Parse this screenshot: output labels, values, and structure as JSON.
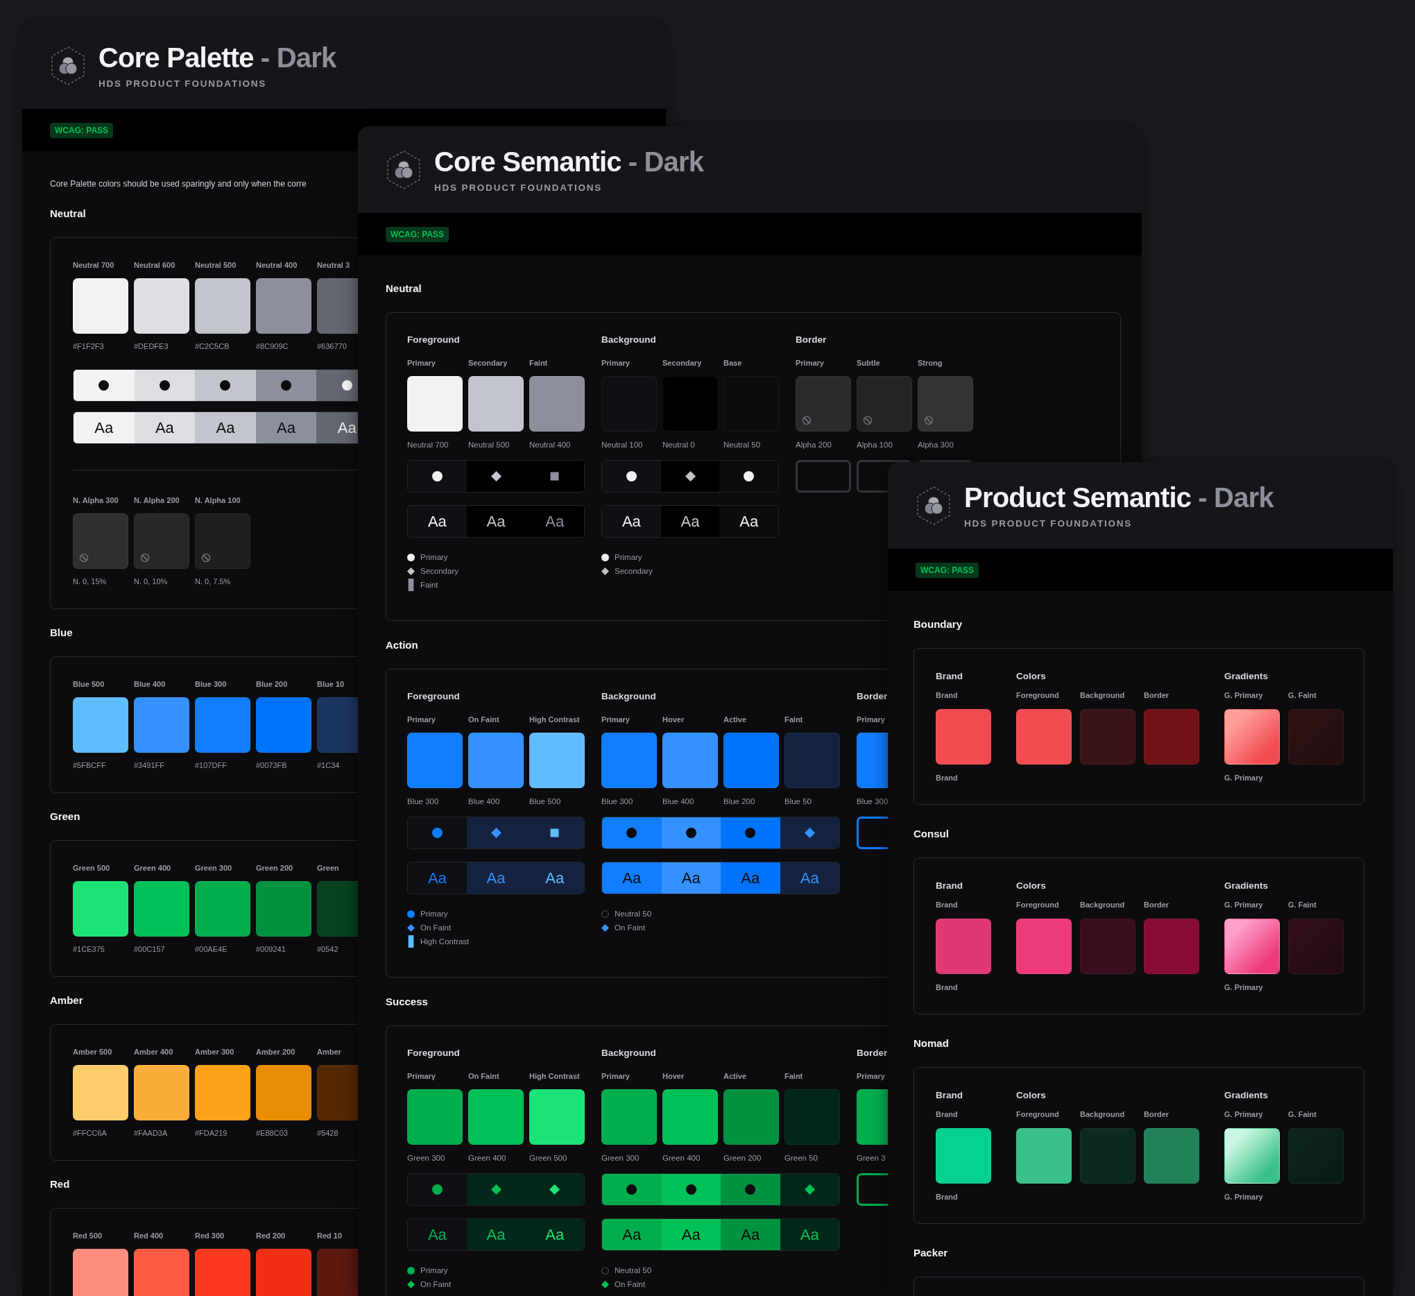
{
  "frames": [
    {
      "kind": "palette",
      "title": "Core Palette",
      "variant": "- Dark",
      "subtitle": "HDS PRODUCT FOUNDATIONS",
      "badge": "WCAG: PASS",
      "description": "Core Palette colors should be used sparingly and only when the corre",
      "sections": [
        {
          "kind": "neutral",
          "name": "Neutral",
          "swatches": [
            {
              "label": "Neutral 700",
              "color": "#f1f2f3",
              "hex": "#F1F2F3"
            },
            {
              "label": "Neutral 600",
              "color": "#dedfe3",
              "hex": "#DEDFE3"
            },
            {
              "label": "Neutral 500",
              "color": "#c2c5cb",
              "hex": "#C2C5CB"
            },
            {
              "label": "Neutral 400",
              "color": "#8c909c",
              "hex": "#8C909C"
            },
            {
              "label": "Neutral 3",
              "color": "#636770",
              "hex": "#636770"
            }
          ],
          "samples": [
            "Aa",
            "Aa",
            "Aa",
            "Aa",
            "Aa"
          ],
          "alphas": [
            {
              "label": "N. Alpha 300",
              "color": "#2f2f32",
              "value": "N. 0, 15%"
            },
            {
              "label": "N. Alpha 200",
              "color": "#27272a",
              "value": "N. 0, 10%"
            },
            {
              "label": "N. Alpha 100",
              "color": "#1f1f22",
              "value": "N. 0, 7.5%"
            }
          ]
        },
        {
          "kind": "scale",
          "name": "Blue",
          "swatches": [
            {
              "label": "Blue 500",
              "color": "#5fbcff",
              "hex": "#5FBCFF"
            },
            {
              "label": "Blue 400",
              "color": "#3491ff",
              "hex": "#3491FF"
            },
            {
              "label": "Blue 300",
              "color": "#107dff",
              "hex": "#107DFF"
            },
            {
              "label": "Blue 200",
              "color": "#0073fb",
              "hex": "#0073FB"
            },
            {
              "label": "Blue 10",
              "color": "#1c3460",
              "hex": "#1C34"
            }
          ]
        },
        {
          "kind": "scale",
          "name": "Green",
          "swatches": [
            {
              "label": "Green 500",
              "color": "#1ce375",
              "hex": "#1CE375"
            },
            {
              "label": "Green 400",
              "color": "#00c157",
              "hex": "#00C157"
            },
            {
              "label": "Green 300",
              "color": "#00ae4e",
              "hex": "#00AE4E"
            },
            {
              "label": "Green 200",
              "color": "#009241",
              "hex": "#009241"
            },
            {
              "label": "Green",
              "color": "#05421f",
              "hex": "#0542"
            }
          ]
        },
        {
          "kind": "scale",
          "name": "Amber",
          "swatches": [
            {
              "label": "Amber 500",
              "color": "#ffcc6a",
              "hex": "#FFCC6A"
            },
            {
              "label": "Amber 400",
              "color": "#faad3a",
              "hex": "#FAAD3A"
            },
            {
              "label": "Amber 300",
              "color": "#fda219",
              "hex": "#FDA219"
            },
            {
              "label": "Amber 200",
              "color": "#e88c03",
              "hex": "#E88C03"
            },
            {
              "label": "Amber",
              "color": "#542800",
              "hex": "#5428"
            }
          ]
        },
        {
          "kind": "scale",
          "name": "Red",
          "swatches": [
            {
              "label": "Red 500",
              "color": "#ff8d80"
            },
            {
              "label": "Red 400",
              "color": "#ff5a42"
            },
            {
              "label": "Red 300",
              "color": "#fb3a1f"
            },
            {
              "label": "Red 200",
              "color": "#f12f16"
            },
            {
              "label": "Red 10",
              "color": "#5c170f"
            }
          ]
        }
      ]
    },
    {
      "kind": "semantic",
      "title": "Core Semantic",
      "variant": "- Dark",
      "subtitle": "HDS PRODUCT FOUNDATIONS",
      "badge": "WCAG: PASS",
      "sections": [
        {
          "name": "Neutral",
          "groups": [
            {
              "kind": "scale",
              "title": "Foreground",
              "tokens": [
                {
                  "label": "Primary",
                  "color": "#f1f2f3",
                  "source": "Neutral 700",
                  "marker": {
                    "kind": "circle",
                    "color": "#f1f2f3"
                  },
                  "cell": {
                    "color": "#0f1013"
                  }
                },
                {
                  "label": "Secondary",
                  "color": "#c2c5cb",
                  "source": "Neutral 500",
                  "marker": {
                    "kind": "diamond",
                    "color": "#c2c5cb"
                  },
                  "cell": {
                    "color": "#000000"
                  }
                },
                {
                  "label": "Faint",
                  "color": "#8c909c",
                  "source": "Neutral 400",
                  "marker": {
                    "kind": "square",
                    "color": "#8c909c"
                  },
                  "cell": {
                    "color": "#000000"
                  }
                }
              ],
              "samples": [
                "Aa",
                "Aa",
                "Aa"
              ],
              "legend": [
                {
                  "kind": "circle",
                  "color": "#f1f2f3",
                  "label": "Primary"
                },
                {
                  "kind": "diamond",
                  "color": "#c2c5cb",
                  "label": "Secondary"
                },
                {
                  "kind": "bar",
                  "color": "#8c909c",
                  "label": "Faint"
                }
              ]
            },
            {
              "kind": "scale",
              "title": "Background",
              "tokens": [
                {
                  "label": "Primary",
                  "color": "#0f1013",
                  "source": "Neutral 100",
                  "marker": {
                    "kind": "circle",
                    "color": "#f1f2f3"
                  },
                  "cell": {
                    "color": "#0f1013"
                  }
                },
                {
                  "label": "Secondary",
                  "color": "#000000",
                  "source": "Neutral 0",
                  "marker": {
                    "kind": "diamond",
                    "color": "#c2c5cb"
                  },
                  "cell": {
                    "color": "#000000"
                  }
                },
                {
                  "label": "Base",
                  "color": "#0c0c0e",
                  "source": "Neutral 50",
                  "marker": {
                    "kind": "circle",
                    "color": "#f1f2f3"
                  },
                  "cell": {
                    "color": "#0c0c0e"
                  }
                }
              ],
              "samples": [
                "Aa",
                "Aa",
                "Aa"
              ],
              "legend": [
                {
                  "kind": "circle",
                  "color": "#f1f2f3",
                  "label": "Primary"
                },
                {
                  "kind": "diamond",
                  "color": "#c2c5cb",
                  "label": "Secondary"
                }
              ]
            },
            {
              "kind": "alpha-border",
              "title": "Border",
              "tokens": [
                {
                  "label": "Primary",
                  "color": "#2b2b2e",
                  "source": "Alpha 200"
                },
                {
                  "label": "Subtle",
                  "color": "#232326",
                  "source": "Alpha 100"
                },
                {
                  "label": "Strong",
                  "color": "#333336",
                  "source": "Alpha 300"
                }
              ]
            }
          ]
        },
        {
          "name": "Action",
          "groups": [
            {
              "kind": "scale",
              "title": "Foreground",
              "tokens": [
                {
                  "label": "Primary",
                  "color": "#107dff",
                  "source": "Blue 300",
                  "marker": {
                    "kind": "circle",
                    "color": "#107dff"
                  },
                  "cell": {
                    "color": "#0f1013"
                  }
                },
                {
                  "label": "On Faint",
                  "color": "#3491ff",
                  "source": "Blue 400",
                  "marker": {
                    "kind": "diamond",
                    "color": "#3491ff"
                  },
                  "cell": {
                    "color": "#15223f"
                  }
                },
                {
                  "label": "High Contrast",
                  "color": "#5fbcff",
                  "source": "Blue 500",
                  "marker": {
                    "kind": "square",
                    "color": "#5fbcff"
                  },
                  "cell": {
                    "color": "#15223f"
                  }
                }
              ],
              "samples": [
                "Aa",
                "Aa",
                "Aa"
              ],
              "legend": [
                {
                  "kind": "circle",
                  "color": "#107dff",
                  "label": "Primary"
                },
                {
                  "kind": "diamond",
                  "color": "#3491ff",
                  "label": "On Faint"
                },
                {
                  "kind": "bar",
                  "color": "#5fbcff",
                  "label": "High Contrast"
                }
              ]
            },
            {
              "kind": "scale",
              "title": "Background",
              "tokens": [
                {
                  "label": "Primary",
                  "color": "#107dff",
                  "source": "Blue 300",
                  "marker": {
                    "kind": "circle",
                    "color": "#0c0c0e"
                  },
                  "cell": {
                    "color": "#107dff"
                  }
                },
                {
                  "label": "Hover",
                  "color": "#3491ff",
                  "source": "Blue 400",
                  "marker": {
                    "kind": "circle",
                    "color": "#0c0c0e"
                  },
                  "cell": {
                    "color": "#3491ff"
                  }
                },
                {
                  "label": "Active",
                  "color": "#0073fb",
                  "source": "Blue 200",
                  "marker": {
                    "kind": "circle",
                    "color": "#0c0c0e"
                  },
                  "cell": {
                    "color": "#0073fb"
                  }
                },
                {
                  "label": "Faint",
                  "color": "#15223f",
                  "source": "Blue 50",
                  "marker": {
                    "kind": "diamond",
                    "color": "#3491ff"
                  },
                  "cell": {
                    "color": "#15223f"
                  }
                }
              ],
              "samples": [
                "Aa",
                "Aa",
                "Aa",
                "Aa"
              ],
              "legend": [
                {
                  "kind": "ring",
                  "color": "#3a3b40",
                  "label": "Neutral 50"
                },
                {
                  "kind": "diamond",
                  "color": "#3491ff",
                  "label": "On Faint"
                }
              ]
            },
            {
              "kind": "border",
              "title": "Border",
              "tokens": [
                {
                  "label": "Primary",
                  "color": "#107dff",
                  "source": "Blue 300"
                }
              ]
            }
          ]
        },
        {
          "name": "Success",
          "groups": [
            {
              "kind": "scale",
              "title": "Foreground",
              "tokens": [
                {
                  "label": "Primary",
                  "color": "#00ae4e",
                  "source": "Green 300",
                  "marker": {
                    "kind": "circle",
                    "color": "#00ae4e"
                  },
                  "cell": {
                    "color": "#0f1013"
                  }
                },
                {
                  "label": "On Faint",
                  "color": "#00c157",
                  "source": "Green 400",
                  "marker": {
                    "kind": "diamond",
                    "color": "#00c157"
                  },
                  "cell": {
                    "color": "#03271a"
                  }
                },
                {
                  "label": "High Contrast",
                  "color": "#1ce375",
                  "source": "Green 500",
                  "marker": {
                    "kind": "diamond",
                    "color": "#1ce375"
                  },
                  "cell": {
                    "color": "#03271a"
                  }
                }
              ],
              "samples": [
                "Aa",
                "Aa",
                "Aa"
              ],
              "legend": [
                {
                  "kind": "circle",
                  "color": "#00ae4e",
                  "label": "Primary"
                },
                {
                  "kind": "diamond",
                  "color": "#00c157",
                  "label": "On Faint"
                }
              ]
            },
            {
              "kind": "scale",
              "title": "Background",
              "tokens": [
                {
                  "label": "Primary",
                  "color": "#00ae4e",
                  "source": "Green 300",
                  "marker": {
                    "kind": "circle",
                    "color": "#0c0c0e"
                  },
                  "cell": {
                    "color": "#00ae4e"
                  }
                },
                {
                  "label": "Hover",
                  "color": "#00c157",
                  "source": "Green 400",
                  "marker": {
                    "kind": "circle",
                    "color": "#0c0c0e"
                  },
                  "cell": {
                    "color": "#00c157"
                  }
                },
                {
                  "label": "Active",
                  "color": "#009241",
                  "source": "Green 200",
                  "marker": {
                    "kind": "circle",
                    "color": "#0c0c0e"
                  },
                  "cell": {
                    "color": "#009241"
                  }
                },
                {
                  "label": "Faint",
                  "color": "#03271a",
                  "source": "Green 50",
                  "marker": {
                    "kind": "diamond",
                    "color": "#00c157"
                  },
                  "cell": {
                    "color": "#03271a"
                  }
                }
              ],
              "samples": [
                "Aa",
                "Aa",
                "Aa",
                "Aa"
              ],
              "legend": [
                {
                  "kind": "ring",
                  "color": "#3a3b40",
                  "label": "Neutral 50"
                },
                {
                  "kind": "diamond",
                  "color": "#00c157",
                  "label": "On Faint"
                }
              ]
            },
            {
              "kind": "border",
              "title": "Border",
              "tokens": [
                {
                  "label": "Primary",
                  "color": "#00ae4e",
                  "source": "Green 3"
                }
              ]
            }
          ]
        }
      ]
    },
    {
      "kind": "product",
      "title": "Product Semantic",
      "variant": "- Dark",
      "subtitle": "HDS PRODUCT FOUNDATIONS",
      "badge": "WCAG: PASS",
      "sections": [
        {
          "kind": "full",
          "name": "Boundary",
          "groups": [
            {
              "kind": "solid",
              "title": "Brand",
              "tokens": [
                {
                  "label": "Brand",
                  "color": "#f24c53",
                  "caption": "Brand"
                }
              ]
            },
            {
              "kind": "solid",
              "title": "Colors",
              "tokens": [
                {
                  "label": "Foreground",
                  "color": "#f24c53"
                },
                {
                  "label": "Background",
                  "color": "#3a1417"
                },
                {
                  "label": "Border",
                  "color": "#721216"
                }
              ]
            },
            {
              "kind": "gradient",
              "title": "Gradients",
              "tokens": [
                {
                  "label": "G. Primary",
                  "stops": [
                    {
                      "color": "#ff9f98"
                    },
                    {
                      "color": "#f24c53"
                    }
                  ],
                  "caption": "G. Primary"
                },
                {
                  "label": "G. Faint",
                  "stops": [
                    {
                      "color": "#2e1113"
                    },
                    {
                      "color": "#240e10"
                    }
                  ]
                }
              ]
            }
          ]
        },
        {
          "kind": "full",
          "name": "Consul",
          "groups": [
            {
              "kind": "solid",
              "title": "Brand",
              "tokens": [
                {
                  "label": "Brand",
                  "color": "#e03875",
                  "caption": "Brand"
                }
              ]
            },
            {
              "kind": "solid",
              "title": "Colors",
              "tokens": [
                {
                  "label": "Foreground",
                  "color": "#ed3a7c"
                },
                {
                  "label": "Background",
                  "color": "#3a0d1f"
                },
                {
                  "label": "Border",
                  "color": "#880a37"
                }
              ]
            },
            {
              "kind": "gradient",
              "title": "Gradients",
              "tokens": [
                {
                  "label": "G. Primary",
                  "stops": [
                    {
                      "color": "#ff9fc8"
                    },
                    {
                      "color": "#ed3a7c"
                    }
                  ],
                  "caption": "G. Primary"
                },
                {
                  "label": "G. Faint",
                  "stops": [
                    {
                      "color": "#300e1b"
                    },
                    {
                      "color": "#240b15"
                    }
                  ]
                }
              ]
            }
          ]
        },
        {
          "kind": "full",
          "name": "Nomad",
          "groups": [
            {
              "kind": "solid",
              "title": "Brand",
              "tokens": [
                {
                  "label": "Brand",
                  "color": "#06d092",
                  "caption": "Brand"
                }
              ]
            },
            {
              "kind": "solid",
              "title": "Colors",
              "tokens": [
                {
                  "label": "Foreground",
                  "color": "#3cc08a"
                },
                {
                  "label": "Background",
                  "color": "#0d2a20"
                },
                {
                  "label": "Border",
                  "color": "#23815a"
                }
              ]
            },
            {
              "kind": "gradient",
              "title": "Gradients",
              "tokens": [
                {
                  "label": "G. Primary",
                  "stops": [
                    {
                      "color": "#c9f8e2"
                    },
                    {
                      "color": "#3cc08a"
                    }
                  ],
                  "caption": "G. Primary"
                },
                {
                  "label": "G. Faint",
                  "stops": [
                    {
                      "color": "#0e261d"
                    },
                    {
                      "color": "#0a1c16"
                    }
                  ]
                }
              ]
            }
          ]
        },
        {
          "kind": "cut",
          "name": "Packer"
        }
      ]
    }
  ]
}
